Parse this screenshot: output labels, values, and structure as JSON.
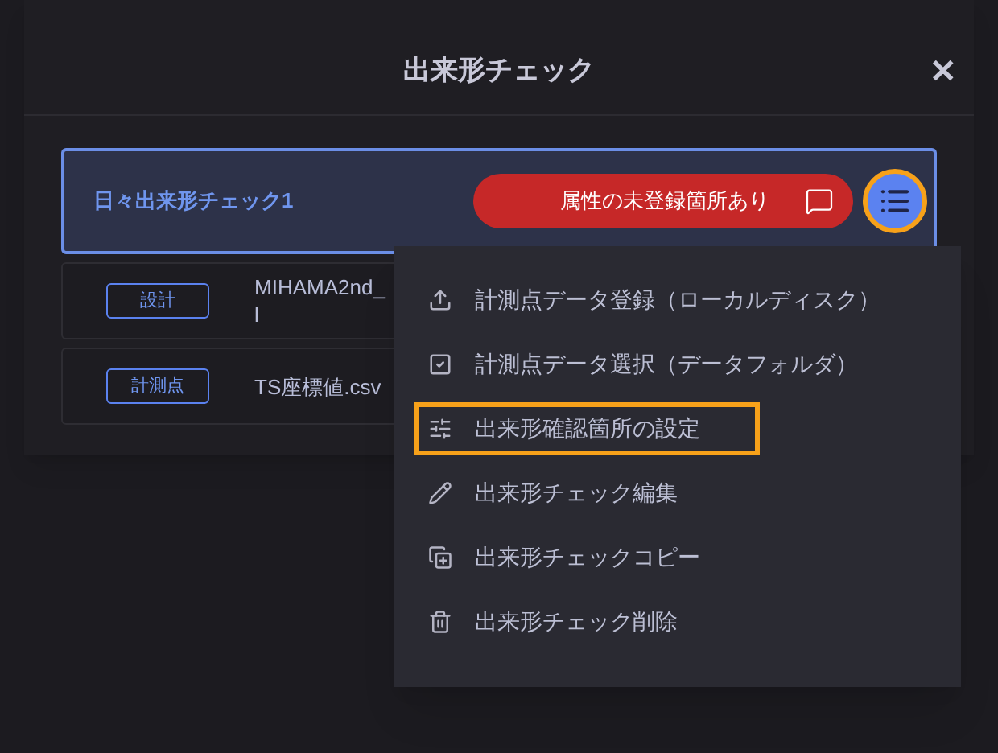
{
  "dialog": {
    "title": "出来形チェック",
    "close": "✕"
  },
  "check": {
    "name": "日々出来形チェック1",
    "status": "属性の未登録箇所あり",
    "menu_focused": true
  },
  "files": [
    {
      "type": "設計",
      "name_lines": [
        "MIHAMA2nd_",
        "l"
      ]
    },
    {
      "type": "計測点",
      "name_lines": [
        "TS座標値.csv"
      ]
    }
  ],
  "menu": [
    {
      "kind": "upload",
      "label": "計測点データ登録（ローカルディスク）",
      "highlighted": false
    },
    {
      "kind": "select",
      "label": "計測点データ選択（データフォルダ）",
      "highlighted": false
    },
    {
      "kind": "settings",
      "label": "出来形確認箇所の設定",
      "highlighted": true
    },
    {
      "kind": "edit",
      "label": "出来形チェック編集",
      "highlighted": false
    },
    {
      "kind": "copy",
      "label": "出来形チェックコピー",
      "highlighted": false
    },
    {
      "kind": "delete",
      "label": "出来形チェック削除",
      "highlighted": false
    }
  ]
}
